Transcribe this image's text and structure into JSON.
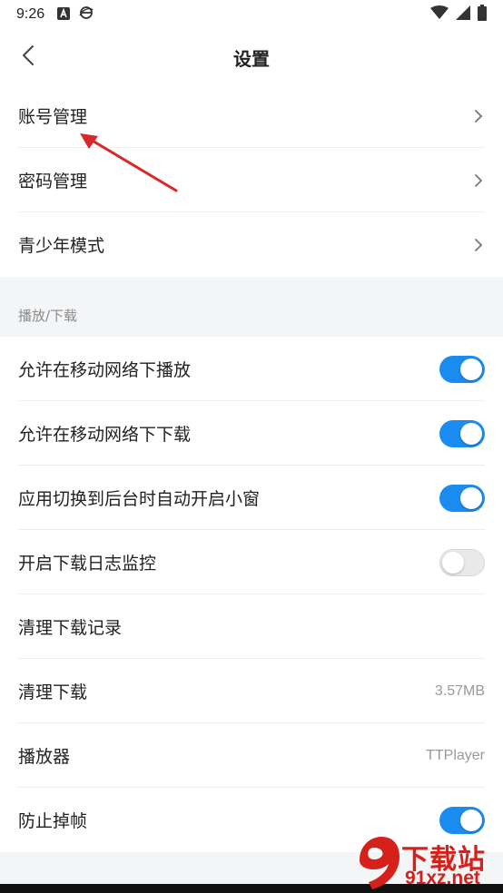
{
  "status_bar": {
    "time": "9:26",
    "left_icons": [
      "font-a-icon",
      "browser-e-icon"
    ],
    "right_icons": [
      "wifi-icon",
      "signal-icon",
      "battery-icon"
    ]
  },
  "header": {
    "title": "设置",
    "back_icon": "chevron-left-icon"
  },
  "account_section": {
    "items": [
      {
        "label": "账号管理",
        "icon": "chevron-right-icon"
      },
      {
        "label": "密码管理",
        "icon": "chevron-right-icon"
      },
      {
        "label": "青少年模式",
        "icon": "chevron-right-icon"
      }
    ]
  },
  "playback_section": {
    "title": "播放/下载",
    "items": [
      {
        "label": "允许在移动网络下播放",
        "toggle": true
      },
      {
        "label": "允许在移动网络下下载",
        "toggle": true
      },
      {
        "label": "应用切换到后台时自动开启小窗",
        "toggle": true
      },
      {
        "label": "开启下载日志监控",
        "toggle": false
      },
      {
        "label": "清理下载记录"
      },
      {
        "label": "清理下载",
        "value": "3.57MB"
      },
      {
        "label": "播放器",
        "value": "TTPlayer"
      },
      {
        "label": "防止掉帧",
        "toggle": true
      }
    ]
  },
  "watermark": {
    "brand": "下载站",
    "domain": "91xz.net"
  },
  "colors": {
    "accent": "#1a8cf0",
    "annotation_arrow": "#d9282a",
    "watermark": "#d6201a"
  }
}
